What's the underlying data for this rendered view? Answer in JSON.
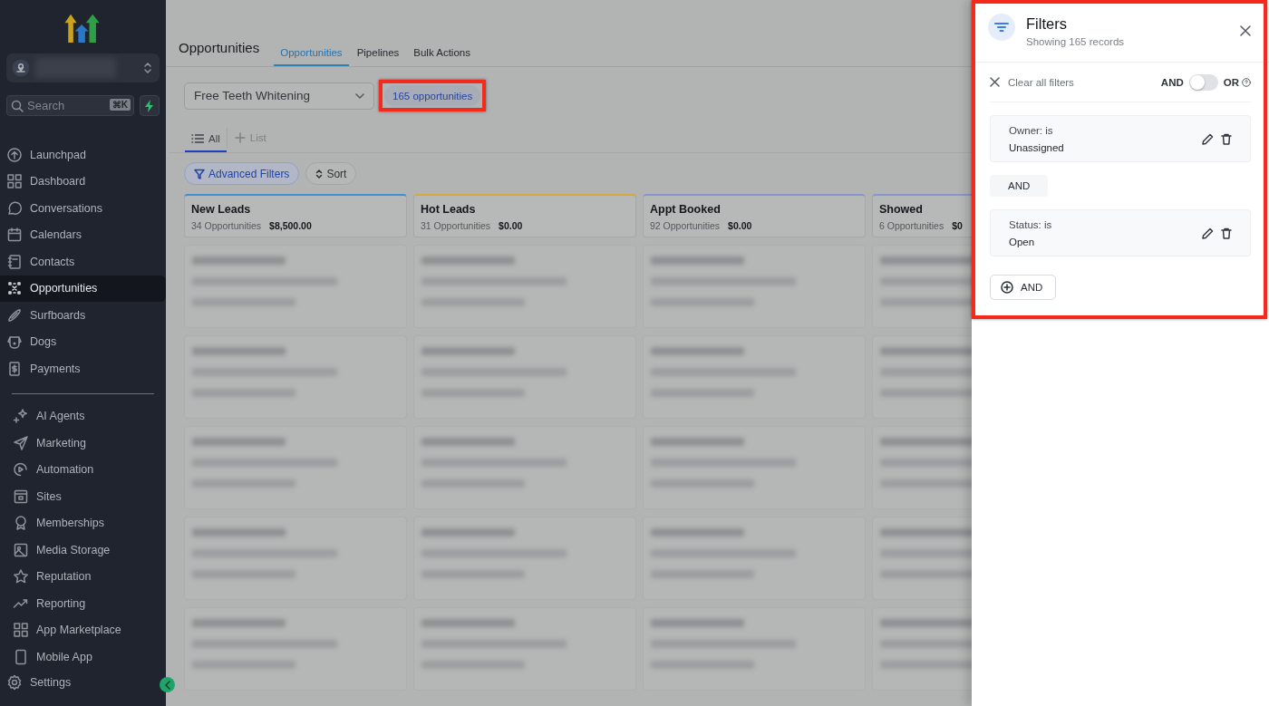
{
  "sidebar": {
    "search": {
      "placeholder": "Search",
      "shortcut": "⌘K"
    },
    "nav_groups": [
      [
        {
          "label": "Launchpad",
          "selected": false
        },
        {
          "label": "Dashboard",
          "selected": false
        },
        {
          "label": "Conversations",
          "selected": false
        },
        {
          "label": "Calendars",
          "selected": false
        },
        {
          "label": "Contacts",
          "selected": false
        },
        {
          "label": "Opportunities",
          "selected": true
        },
        {
          "label": "Surfboards",
          "selected": false
        },
        {
          "label": "Dogs",
          "selected": false
        },
        {
          "label": "Payments",
          "selected": false
        }
      ],
      [
        {
          "label": "AI Agents",
          "selected": false
        },
        {
          "label": "Marketing",
          "selected": false
        },
        {
          "label": "Automation",
          "selected": false
        },
        {
          "label": "Sites",
          "selected": false
        },
        {
          "label": "Memberships",
          "selected": false
        },
        {
          "label": "Media Storage",
          "selected": false
        },
        {
          "label": "Reputation",
          "selected": false
        },
        {
          "label": "Reporting",
          "selected": false
        },
        {
          "label": "App Marketplace",
          "selected": false
        },
        {
          "label": "Mobile App",
          "selected": false
        }
      ]
    ],
    "settings": {
      "label": "Settings"
    }
  },
  "header": {
    "title": "Opportunities",
    "tabs": [
      {
        "label": "Opportunities",
        "selected": true
      },
      {
        "label": "Pipelines",
        "selected": false
      },
      {
        "label": "Bulk Actions",
        "selected": false
      }
    ]
  },
  "toolbar": {
    "pipeline": "Free Teeth Whitening",
    "count": {
      "label": "165 opportunities",
      "highlighted": true
    }
  },
  "view_tabs": [
    {
      "label": "All",
      "kind": "view",
      "selected": true
    },
    {
      "label": "List",
      "kind": "add",
      "selected": false
    }
  ],
  "actions": [
    {
      "label": "Advanced Filters",
      "kind": "filter",
      "active": true
    },
    {
      "label": "Sort",
      "kind": "sort",
      "active": false
    }
  ],
  "columns": [
    {
      "name": "New Leads",
      "count": "34 Opportunities",
      "value": "$8,500.00",
      "color": "#3d8fd6"
    },
    {
      "name": "Hot Leads",
      "count": "31 Opportunities",
      "value": "$0.00",
      "color": "#d8a93a"
    },
    {
      "name": "Appt Booked",
      "count": "92 Opportunities",
      "value": "$0.00",
      "color": "#8a96d2"
    },
    {
      "name": "Showed",
      "count": "6 Opportunities",
      "value": "$0",
      "color": "#8a96d2"
    }
  ],
  "filters_panel": {
    "title": "Filters",
    "subtitle": "Showing 165 records",
    "highlighted": true,
    "clear_label": "Clear all filters",
    "logic": {
      "left": "AND",
      "right": "OR",
      "on": false
    },
    "items": [
      {
        "kind": "condition",
        "field": "Owner: is",
        "value": "Unassigned"
      },
      {
        "kind": "connector",
        "label": "AND"
      },
      {
        "kind": "condition",
        "field": "Status: is",
        "value": "Open"
      }
    ],
    "add_label": "AND"
  }
}
